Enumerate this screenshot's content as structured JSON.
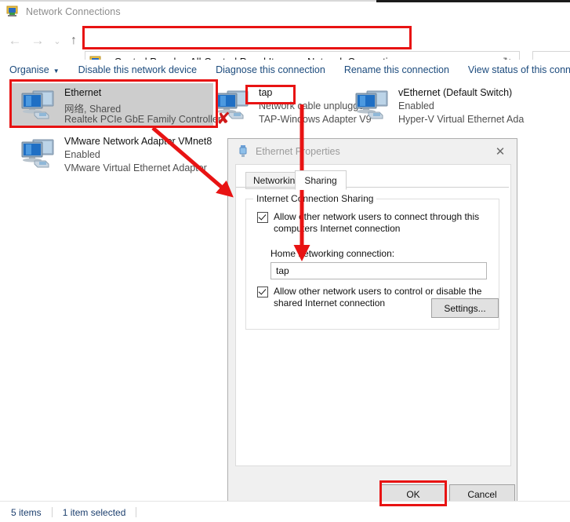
{
  "window": {
    "title": "Network Connections",
    "title_icon": "network-connections-icon"
  },
  "address_bar": {
    "icon": "network-connections-icon",
    "crumbs": [
      "Control Panel",
      "All Control Panel Items",
      "Network Connections"
    ],
    "separator": "›",
    "dropdown_icon": "chevron-down-icon",
    "refresh_icon": "refresh-icon",
    "search_value": "",
    "search_placeholder": ""
  },
  "nav": {
    "back_icon": "←",
    "forward_icon": "→",
    "history_icon": "⌄",
    "up_icon": "↑"
  },
  "command_bar": {
    "organise": "Organise",
    "organise_caret": "▼",
    "disable": "Disable this network device",
    "diagnose": "Diagnose this connection",
    "rename": "Rename this connection",
    "view_status": "View status of this conn"
  },
  "items": [
    {
      "name": "Ethernet",
      "status": "网络, Shared",
      "device": "Realtek PCIe GbE Family Controller",
      "icon": "network-adapter-icon",
      "selected": true,
      "disconnected": false
    },
    {
      "name": "tap",
      "status": "Network cable unplugged",
      "device": "TAP-Windows Adapter V9",
      "icon": "network-adapter-icon",
      "selected": false,
      "disconnected": true
    },
    {
      "name": "vEthernet (Default Switch)",
      "status": "Enabled",
      "device": "Hyper-V Virtual Ethernet Ada",
      "icon": "network-adapter-icon",
      "selected": false,
      "disconnected": false
    },
    {
      "name": "VMware Network Adapter VMnet8",
      "status": "Enabled",
      "device": "VMware Virtual Ethernet Adapter",
      "icon": "network-adapter-icon",
      "selected": false,
      "disconnected": false
    }
  ],
  "status_bar": {
    "items_count": "5 items",
    "selection": "1 item selected"
  },
  "dialog": {
    "title": "Ethernet Properties",
    "title_icon": "adapter-icon",
    "close_icon": "✕",
    "tabs": [
      {
        "label": "Networking",
        "active": false
      },
      {
        "label": "Sharing",
        "active": true
      }
    ],
    "group_legend": "Internet Connection Sharing",
    "checkbox_connect": {
      "label": "Allow other network users to connect through this computers Internet connection",
      "checked": true
    },
    "home_networking_label": "Home networking connection:",
    "home_networking_value": "tap",
    "checkbox_control": {
      "label": "Allow other network users to control or disable the shared Internet connection",
      "checked": true
    },
    "settings_button": "Settings...",
    "ok_button": "OK",
    "cancel_button": "Cancel"
  },
  "annotations": {
    "accent_color": "#e81313",
    "boxes": [
      "address-bar",
      "ethernet-item",
      "tap-item-name",
      "ok-button"
    ],
    "arrows": [
      "ethernet-to-dialog",
      "tap-to-home-networking"
    ]
  }
}
